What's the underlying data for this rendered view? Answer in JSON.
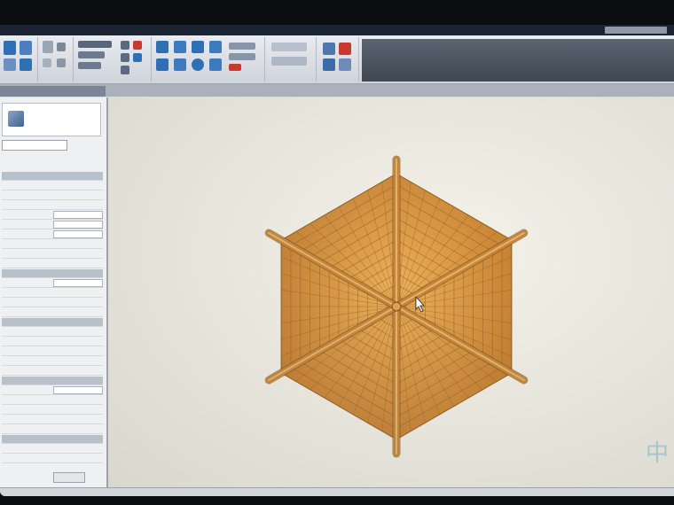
{
  "window": {
    "title_field": ""
  },
  "ribbon": {
    "groups": [
      "",
      "",
      "",
      "",
      "",
      ""
    ],
    "colors": {
      "accent_blue": "#2f6fb5",
      "accent_red": "#c83a2f"
    }
  },
  "palette": {
    "type_name": "",
    "type_select": "",
    "edit_type": "",
    "apply": "",
    "rows": [
      {
        "k": "",
        "v": "",
        "hdr": true
      },
      {
        "k": "",
        "v": ""
      },
      {
        "k": "",
        "v": ""
      },
      {
        "k": "",
        "v": ""
      },
      {
        "k": "",
        "v": "",
        "box": true
      },
      {
        "k": "",
        "v": "",
        "box": true
      },
      {
        "k": "",
        "v": "",
        "box": true
      },
      {
        "k": "",
        "v": ""
      },
      {
        "k": "",
        "v": ""
      },
      {
        "k": "",
        "v": ""
      },
      {
        "k": "",
        "v": "",
        "hdr": true
      },
      {
        "k": "",
        "v": "",
        "box": true
      },
      {
        "k": "",
        "v": ""
      },
      {
        "k": "",
        "v": ""
      },
      {
        "k": "",
        "v": ""
      },
      {
        "k": "",
        "v": "",
        "hdr": true
      },
      {
        "k": "",
        "v": ""
      },
      {
        "k": "",
        "v": ""
      },
      {
        "k": "",
        "v": ""
      },
      {
        "k": "",
        "v": ""
      },
      {
        "k": "",
        "v": ""
      },
      {
        "k": "",
        "v": "",
        "hdr": true
      },
      {
        "k": "",
        "v": "",
        "box": true
      },
      {
        "k": "",
        "v": ""
      },
      {
        "k": "",
        "v": ""
      },
      {
        "k": "",
        "v": ""
      },
      {
        "k": "",
        "v": ""
      },
      {
        "k": "",
        "v": "",
        "hdr": true
      },
      {
        "k": "",
        "v": ""
      },
      {
        "k": "",
        "v": ""
      }
    ]
  },
  "canvas": {
    "model": "hexagonal-bamboo-roof",
    "colors": {
      "roof": "#d8953e",
      "pole": "#c98638",
      "line": "#8c5a1e"
    },
    "watermark": "中"
  },
  "statusbar": {
    "text": ""
  }
}
